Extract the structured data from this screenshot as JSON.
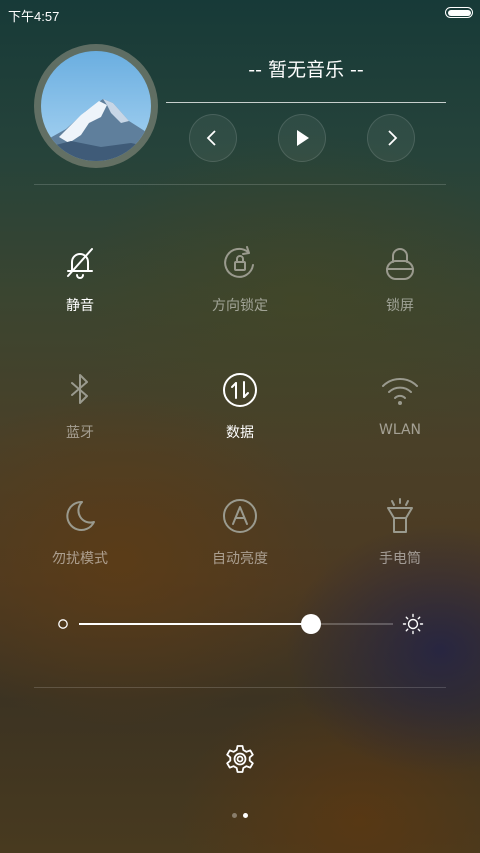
{
  "status_bar": {
    "time": "下午4:57",
    "battery_icon": "battery-full-icon"
  },
  "music": {
    "title": "-- 暂无音乐 --",
    "album_art": "mountain-album-art",
    "controls": {
      "prev_icon": "chevron-left-icon",
      "play_icon": "play-icon",
      "next_icon": "chevron-right-icon"
    }
  },
  "toggles": [
    {
      "label": "静音",
      "icon": "bell-muted-icon",
      "active": true
    },
    {
      "label": "方向锁定",
      "icon": "rotation-lock-icon",
      "active": false
    },
    {
      "label": "锁屏",
      "icon": "lock-icon",
      "active": false
    },
    {
      "label": "蓝牙",
      "icon": "bluetooth-icon",
      "active": false
    },
    {
      "label": "数据",
      "icon": "mobile-data-icon",
      "active": true
    },
    {
      "label": "WLAN",
      "icon": "wifi-icon",
      "active": false
    },
    {
      "label": "勿扰模式",
      "icon": "moon-icon",
      "active": false
    },
    {
      "label": "自动亮度",
      "icon": "auto-brightness-icon",
      "active": false
    },
    {
      "label": "手电筒",
      "icon": "flashlight-icon",
      "active": false
    }
  ],
  "brightness": {
    "level": 0.74,
    "min_icon": "brightness-low-icon",
    "max_icon": "brightness-high-icon"
  },
  "settings_icon": "gear-icon",
  "pager": {
    "count": 2,
    "active_index": 1
  },
  "colors": {
    "active": "#ffffff",
    "inactive": "#9a9a8e"
  }
}
